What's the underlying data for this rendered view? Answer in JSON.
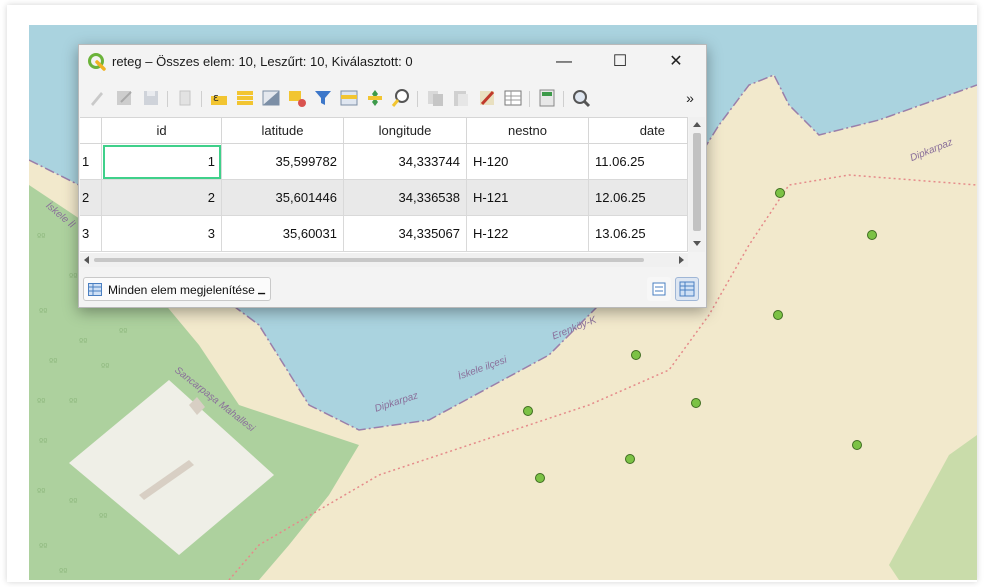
{
  "window": {
    "title": "reteg – Összes elem: 10, Leszűrt: 10, Kiválasztott: 0",
    "minimize": "—",
    "maximize": "☐",
    "close": "✕",
    "overflow": "»"
  },
  "table": {
    "columns": [
      "id",
      "latitude",
      "longitude",
      "nestno",
      "date"
    ],
    "rows": [
      {
        "row": "1",
        "id": "1",
        "latitude": "35,599782",
        "longitude": "34,333744",
        "nestno": "H-120",
        "date": "11.06.25"
      },
      {
        "row": "2",
        "id": "2",
        "latitude": "35,601446",
        "longitude": "34,336538",
        "nestno": "H-121",
        "date": "12.06.25"
      },
      {
        "row": "3",
        "id": "3",
        "latitude": "35,60031",
        "longitude": "34,335067",
        "nestno": "H-122",
        "date": "13.06.25"
      }
    ]
  },
  "bottom": {
    "show_all_label": "Minden elem megjelenítése"
  },
  "map": {
    "labels": {
      "dipkarpaz_top": "Dipkarpaz",
      "iskele_left": "İskele İl",
      "sancarpaza": "Sancarpaşa Mahallesi",
      "dipkarpaz_bottom": "Dipkarpaz",
      "iskele_ilcesi": "İskele ilçesi",
      "erenkoy": "Erenköy-K"
    },
    "colors": {
      "sea": "#aad3df",
      "land": "#f2e9cc",
      "forest": "#add19e",
      "point": "#7cc245"
    }
  }
}
